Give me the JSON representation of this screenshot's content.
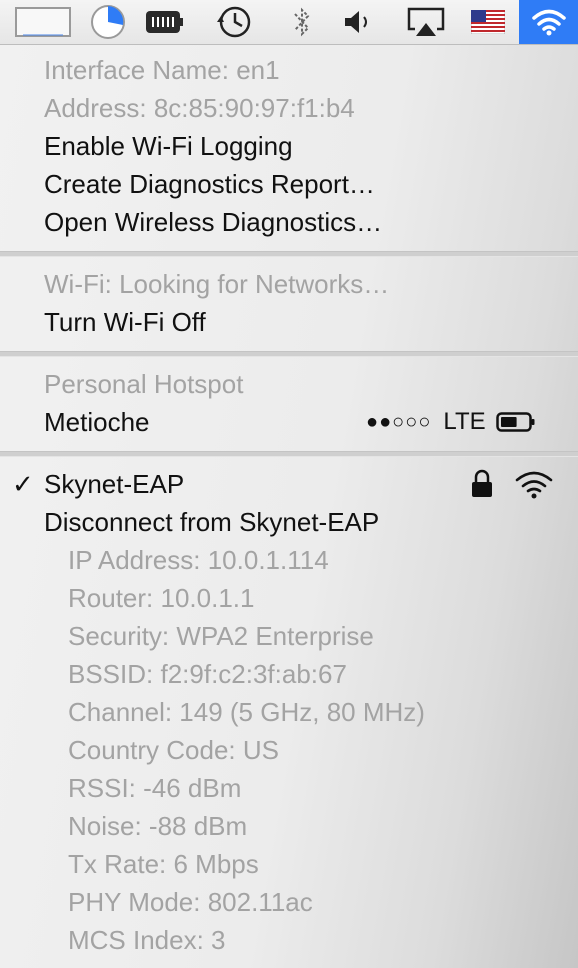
{
  "menubar": {
    "icons": [
      "window-icon",
      "time-machine-progress-icon",
      "battery-icon",
      "clock-icon",
      "bluetooth-icon",
      "volume-icon",
      "airplay-icon",
      "us-flag-icon",
      "wifi-icon"
    ]
  },
  "menu": {
    "interface_name": "Interface Name: en1",
    "address": "Address: 8c:85:90:97:f1:b4",
    "enable_logging": "Enable Wi-Fi Logging",
    "create_report": "Create Diagnostics Report…",
    "open_diagnostics": "Open Wireless Diagnostics…",
    "wifi_status": "Wi-Fi: Looking for Networks…",
    "turn_off": "Turn Wi-Fi Off",
    "hotspot_header": "Personal Hotspot",
    "hotspot_name": "Metioche",
    "hotspot_signal": "●●○○○",
    "hotspot_network": "LTE",
    "hotspot_battery_level": 0.6,
    "connected_check": "✓",
    "connected_network": "Skynet-EAP",
    "disconnect": "Disconnect from Skynet-EAP",
    "details": [
      "IP Address: 10.0.1.114",
      "Router: 10.0.1.1",
      "Security: WPA2 Enterprise",
      "BSSID: f2:9f:c2:3f:ab:67",
      "Channel: 149 (5 GHz, 80 MHz)",
      "Country Code: US",
      "RSSI: -46 dBm",
      "Noise: -88 dBm",
      "Tx Rate: 6 Mbps",
      "PHY Mode: 802.11ac",
      "MCS Index: 3"
    ]
  },
  "colors": {
    "accent": "#2f7cf6",
    "disabled_text": "#a3a3a3",
    "enabled_text": "#111111"
  }
}
